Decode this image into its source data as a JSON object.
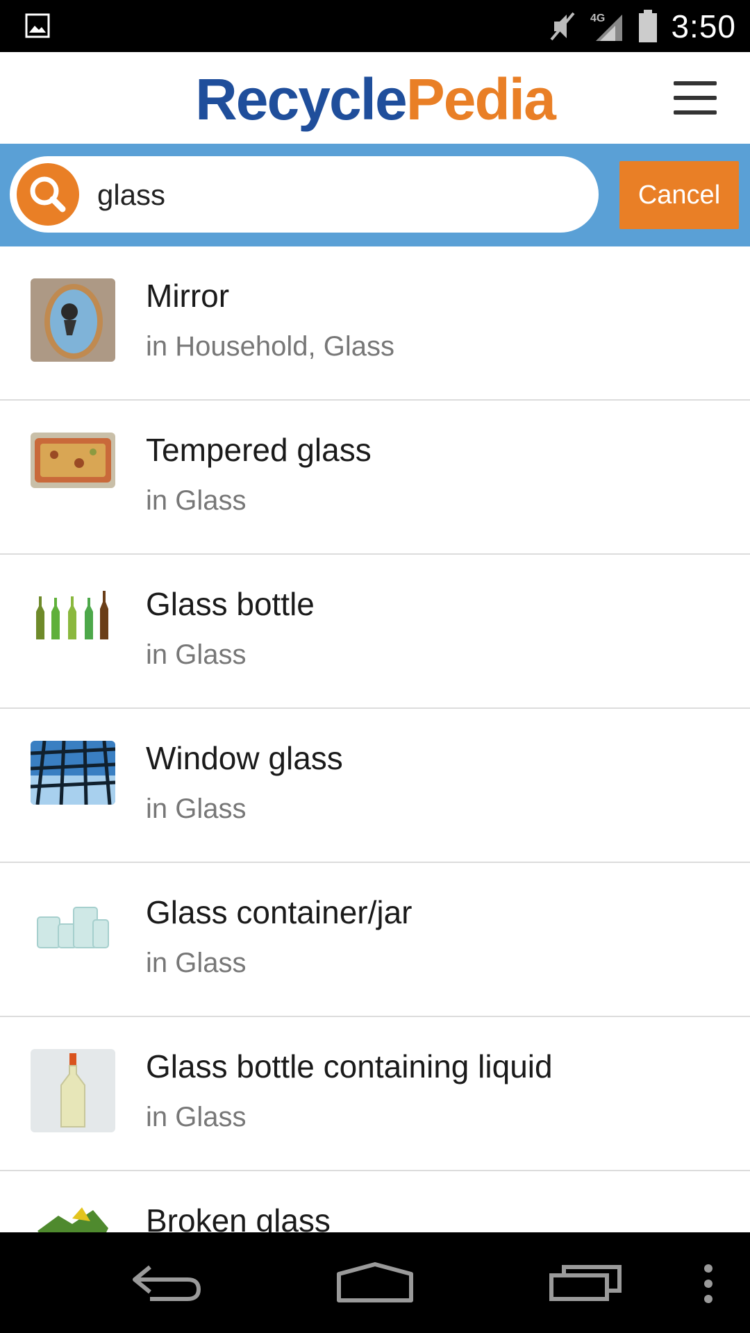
{
  "status_bar": {
    "time": "3:50",
    "network": "4G",
    "icons": [
      "gallery-icon",
      "mute-icon",
      "signal-icon",
      "battery-icon"
    ]
  },
  "header": {
    "logo_part1": "Recycle",
    "logo_part2": "Pedia",
    "menu_icon": "hamburger-menu-icon"
  },
  "search": {
    "value": "glass",
    "cancel_label": "Cancel"
  },
  "results": [
    {
      "title": "Mirror",
      "subtitle": "in Household, Glass",
      "thumb": "mirror"
    },
    {
      "title": "Tempered glass",
      "subtitle": "in Glass",
      "thumb": "tempered-glass-dish"
    },
    {
      "title": "Glass bottle",
      "subtitle": "in Glass",
      "thumb": "glass-bottles"
    },
    {
      "title": "Window glass",
      "subtitle": "in Glass",
      "thumb": "window-glass"
    },
    {
      "title": "Glass container/jar",
      "subtitle": "in Glass",
      "thumb": "glass-jars"
    },
    {
      "title": "Glass bottle containing liquid",
      "subtitle": "in Glass",
      "thumb": "bottle-liquid"
    },
    {
      "title": "Broken glass",
      "subtitle": "",
      "thumb": "broken-glass"
    }
  ],
  "colors": {
    "brand_blue": "#1f4e9b",
    "brand_orange": "#e97f26",
    "search_bar_bg": "#5aa0d6"
  }
}
